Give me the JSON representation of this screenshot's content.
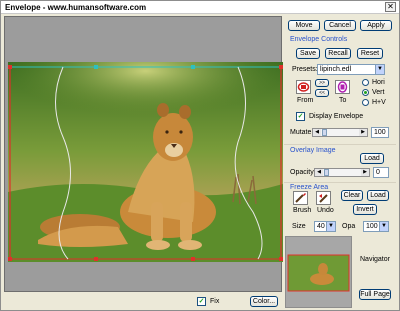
{
  "window": {
    "title": "Envelope - www.humansoftware.com",
    "close_glyph": "✕"
  },
  "canvas_bottom": {
    "fix_label": "Fix",
    "fix_checked": true,
    "color_button": "Color..."
  },
  "top_buttons": {
    "move": "Move",
    "cancel": "Cancel",
    "apply": "Apply"
  },
  "envelope_controls": {
    "heading": "Envelope Controls",
    "save": "Save",
    "recall": "Recall",
    "reset": "Reset",
    "presets_label": "Presets:",
    "presets_value": "lipinch.edl",
    "arrow_right": ">>",
    "arrow_left": "<<",
    "from_label": "From",
    "to_label": "To",
    "radio_hori": "Hori",
    "radio_vert": "Vert",
    "radio_hv": "H+V",
    "selected_radio": "Vert",
    "display_envelope_label": "Display Envelope",
    "display_envelope_checked": true,
    "mutate_label": "Mutate:",
    "mutate_value": "100"
  },
  "overlay_image": {
    "heading": "Overlay Image",
    "load": "Load",
    "opacity_label": "Opacity:",
    "opacity_value": "0"
  },
  "freeze_area": {
    "heading": "Freeze Area",
    "clear": "Clear",
    "load": "Load",
    "invert": "Invert",
    "brush_label": "Brush",
    "undo_label": "Undo",
    "size_label": "Size",
    "size_value": "40",
    "opa_label": "Opa",
    "opa_value": "100"
  },
  "navigator": {
    "label": "Navigator",
    "full_page": "Full Page"
  },
  "colors": {
    "accent": "#2852cc",
    "grass": "#5e8a2a",
    "lion": "#c98a3a",
    "frame": "#e0302a"
  }
}
